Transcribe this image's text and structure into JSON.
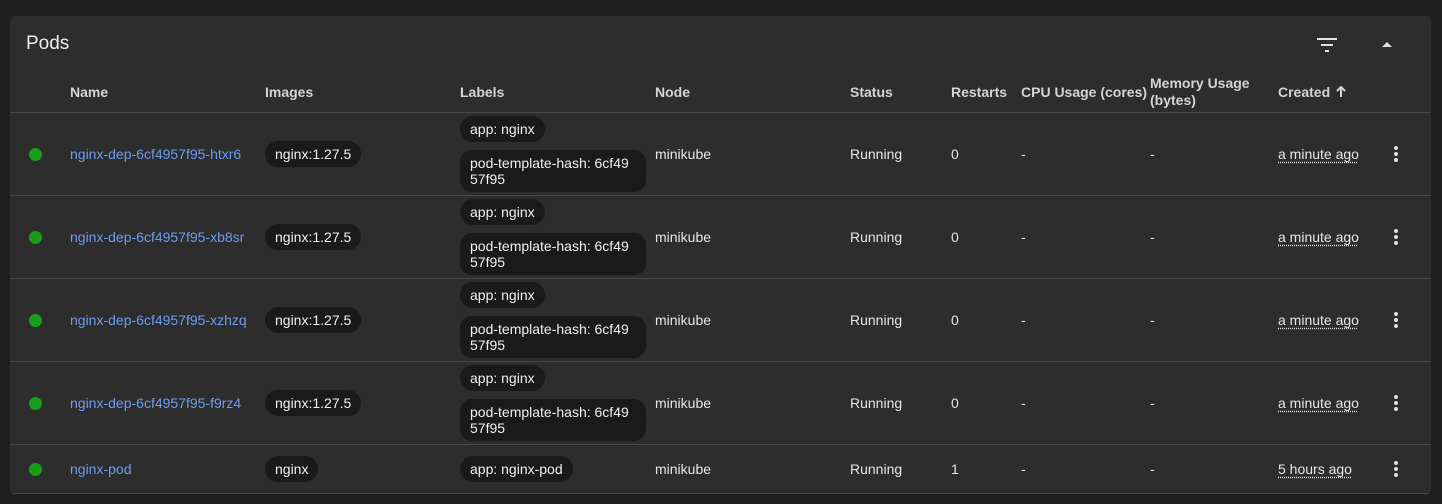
{
  "card": {
    "title": "Pods"
  },
  "columns": {
    "name": "Name",
    "images": "Images",
    "labels": "Labels",
    "node": "Node",
    "status": "Status",
    "restarts": "Restarts",
    "cpu": "CPU Usage (cores)",
    "memory_line1": "Memory Usage",
    "memory_line2": "(bytes)",
    "created": "Created",
    "created_sort_icon": "arrow-up-icon"
  },
  "rows": [
    {
      "name": "nginx-dep-6cf4957f95-htxr6",
      "image": "nginx:1.27.5",
      "label_app": "app: nginx",
      "label_hash": "pod-template-hash: 6cf4957f95",
      "node": "minikube",
      "status": "Running",
      "restarts": "0",
      "cpu": "-",
      "memory": "-",
      "created": "a minute ago",
      "status_color": "#1a9e1a"
    },
    {
      "name": "nginx-dep-6cf4957f95-xb8sr",
      "image": "nginx:1.27.5",
      "label_app": "app: nginx",
      "label_hash": "pod-template-hash: 6cf4957f95",
      "node": "minikube",
      "status": "Running",
      "restarts": "0",
      "cpu": "-",
      "memory": "-",
      "created": "a minute ago",
      "status_color": "#1a9e1a"
    },
    {
      "name": "nginx-dep-6cf4957f95-xzhzq",
      "image": "nginx:1.27.5",
      "label_app": "app: nginx",
      "label_hash": "pod-template-hash: 6cf4957f95",
      "node": "minikube",
      "status": "Running",
      "restarts": "0",
      "cpu": "-",
      "memory": "-",
      "created": "a minute ago",
      "status_color": "#1a9e1a"
    },
    {
      "name": "nginx-dep-6cf4957f95-f9rz4",
      "image": "nginx:1.27.5",
      "label_app": "app: nginx",
      "label_hash": "pod-template-hash: 6cf4957f95",
      "node": "minikube",
      "status": "Running",
      "restarts": "0",
      "cpu": "-",
      "memory": "-",
      "created": "a minute ago",
      "status_color": "#1a9e1a"
    },
    {
      "name": "nginx-pod",
      "image": "nginx",
      "label_app": "app: nginx-pod",
      "label_hash": null,
      "node": "minikube",
      "status": "Running",
      "restarts": "1",
      "cpu": "-",
      "memory": "-",
      "created": "5 hours ago",
      "status_color": "#1a9e1a"
    }
  ],
  "icons": {
    "filter": "filter-icon",
    "collapse": "chevron-up-icon",
    "row_menu": "more-vert-icon"
  }
}
